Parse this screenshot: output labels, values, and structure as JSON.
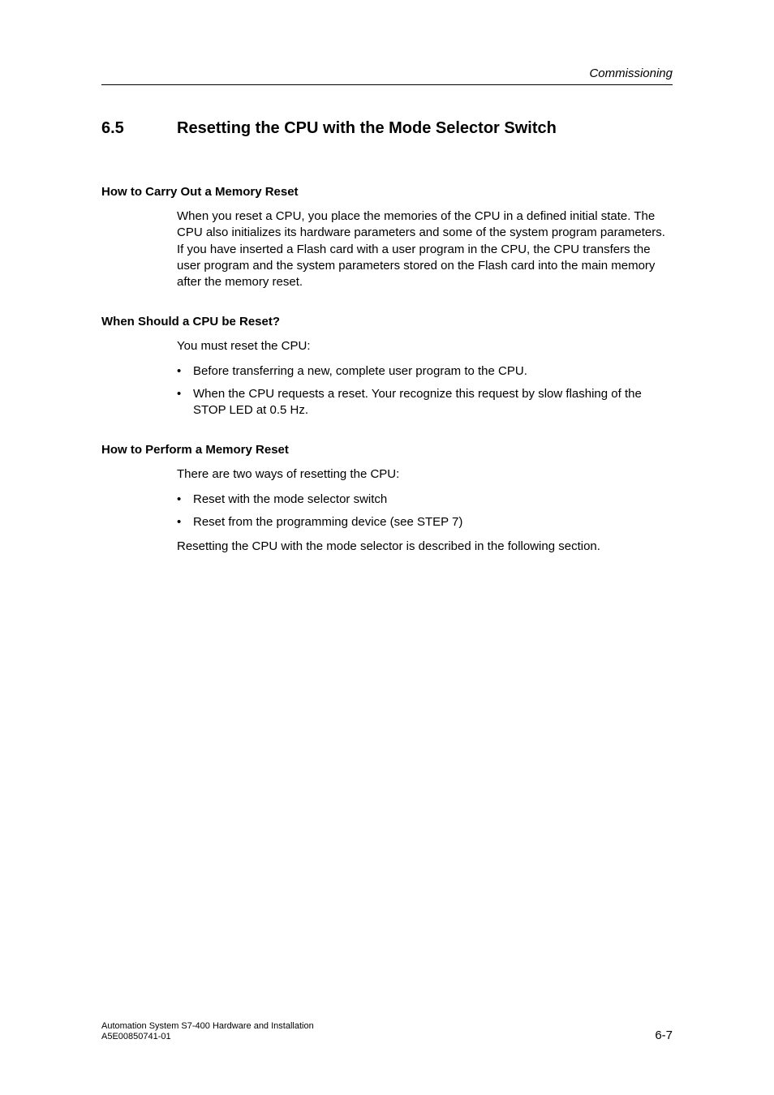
{
  "header": {
    "chapter": "Commissioning"
  },
  "section": {
    "number": "6.5",
    "title": "Resetting the CPU with the Mode Selector Switch"
  },
  "sub1": {
    "heading": "How to Carry Out a Memory Reset",
    "para": "When you reset a CPU, you place the memories of the CPU in a defined initial state. The CPU also initializes its hardware parameters and some of the system program parameters. If you have inserted a Flash card with a user program in the CPU, the CPU transfers the user program and the system parameters stored on the Flash card into the main memory after the memory reset."
  },
  "sub2": {
    "heading": "When Should a CPU be Reset?",
    "intro": "You must reset the CPU:",
    "bullets": {
      "0": "Before transferring a new, complete user program to the CPU.",
      "1": "When the CPU requests a reset. Your recognize this request by slow flashing of the STOP LED at 0.5 Hz."
    }
  },
  "sub3": {
    "heading": "How to Perform a Memory Reset",
    "intro": "There are two ways of resetting the CPU:",
    "bullets": {
      "0": "Reset with the mode selector switch",
      "1": "Reset from the programming device (see STEP 7)"
    },
    "outro": "Resetting the CPU with the mode selector is described in the following section."
  },
  "footer": {
    "line1": "Automation System S7-400  Hardware and Installation",
    "line2": "A5E00850741-01",
    "pagenum": "6-7"
  }
}
